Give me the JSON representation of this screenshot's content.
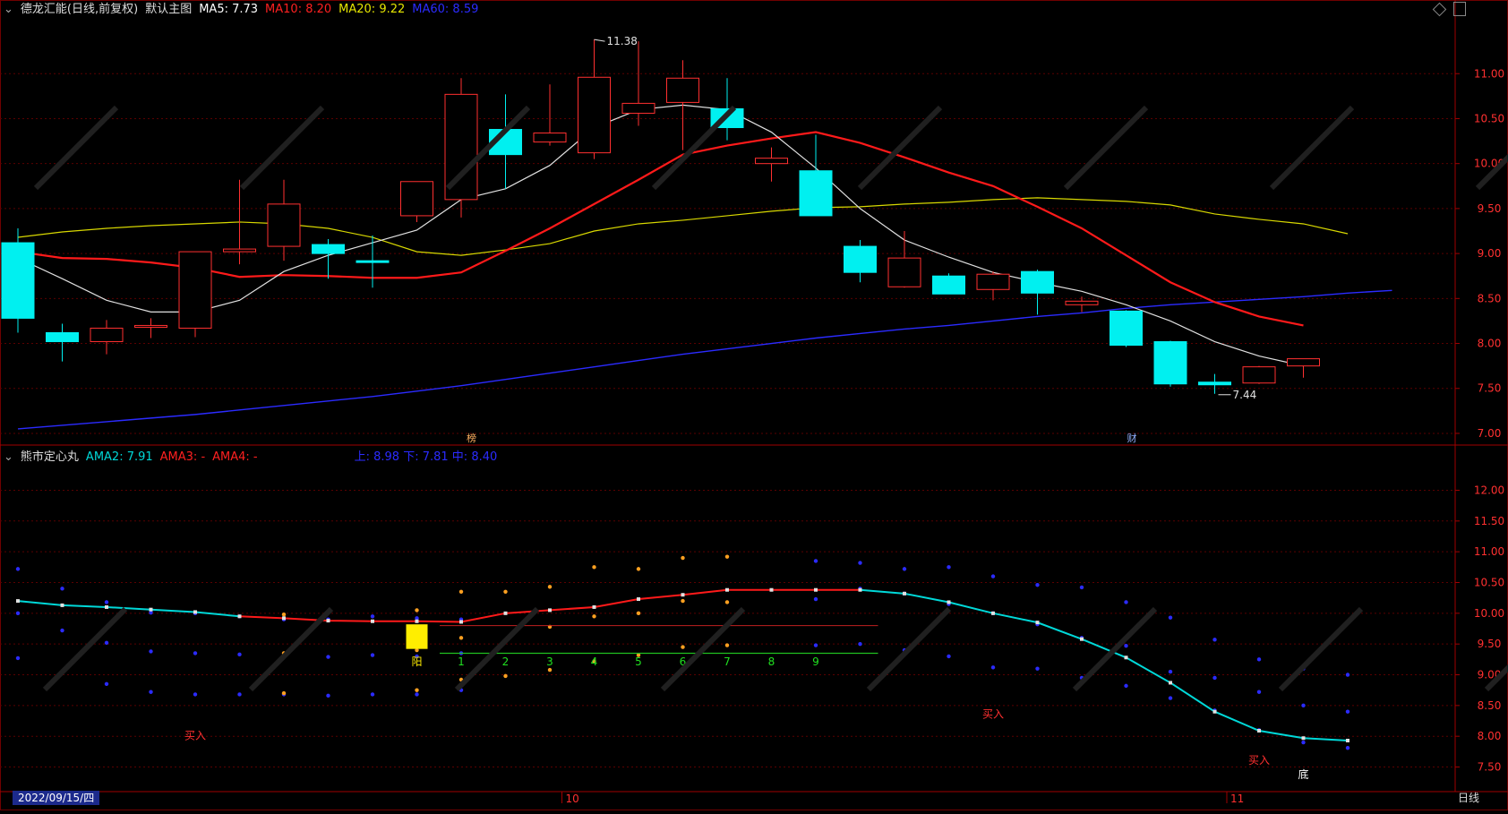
{
  "main": {
    "title": "德龙汇能(日线,前复权)",
    "chart_name": "默认主图",
    "ma": [
      {
        "label": "MA5: 7.73",
        "color": "#ffffff"
      },
      {
        "label": "MA10: 8.20",
        "color": "#ff2020"
      },
      {
        "label": "MA20: 9.22",
        "color": "#e6e600"
      },
      {
        "label": "MA60: 8.59",
        "color": "#2b2bff"
      }
    ],
    "high_label": "11.38",
    "low_label": "7.44",
    "event_marker_1": "榜",
    "event_marker_2": "财"
  },
  "sub": {
    "title": "熊市定心丸",
    "ama2": "AMA2: 7.91",
    "ama3": "AMA3: -",
    "ama4": "AMA4: -",
    "band": "上: 8.98  下: 7.81  中: 8.40",
    "yang_label": "阳",
    "counts": [
      "1",
      "2",
      "3",
      "4",
      "5",
      "6",
      "7",
      "8",
      "9"
    ],
    "buy_label": "买入",
    "bottom_label": "底"
  },
  "footer": {
    "date": "2022/09/15/四",
    "month_oct": "10",
    "month_nov": "11",
    "period_tab": "日线"
  },
  "colors": {
    "up": "#ff3030",
    "down": "#00f0f0",
    "grid": "#5a0000",
    "axis_text": "#ff3030",
    "ama2": "#00d8d8"
  },
  "chart_data": [
    {
      "type": "candlestick",
      "ylim": [
        6.9,
        11.6
      ],
      "yticks": [
        "7.00",
        "7.50",
        "8.00",
        "8.50",
        "9.00",
        "9.50",
        "10.00",
        "10.50",
        "11.00"
      ],
      "candles": [
        {
          "o": 9.12,
          "h": 9.28,
          "l": 8.12,
          "c": 8.28
        },
        {
          "o": 8.12,
          "h": 8.22,
          "l": 7.8,
          "c": 8.02
        },
        {
          "o": 8.02,
          "h": 8.26,
          "l": 7.88,
          "c": 8.17
        },
        {
          "o": 8.18,
          "h": 8.28,
          "l": 8.06,
          "c": 8.2
        },
        {
          "o": 8.17,
          "h": 9.02,
          "l": 8.07,
          "c": 9.02
        },
        {
          "o": 9.02,
          "h": 9.82,
          "l": 8.88,
          "c": 9.05
        },
        {
          "o": 9.08,
          "h": 9.82,
          "l": 8.92,
          "c": 9.55
        },
        {
          "o": 9.1,
          "h": 9.16,
          "l": 8.72,
          "c": 9.0
        },
        {
          "o": 8.92,
          "h": 9.2,
          "l": 8.62,
          "c": 8.9
        },
        {
          "o": 9.42,
          "h": 9.8,
          "l": 9.35,
          "c": 9.8
        },
        {
          "o": 9.6,
          "h": 10.95,
          "l": 9.4,
          "c": 10.77
        },
        {
          "o": 10.38,
          "h": 10.77,
          "l": 9.72,
          "c": 10.1
        },
        {
          "o": 10.24,
          "h": 10.88,
          "l": 10.2,
          "c": 10.34
        },
        {
          "o": 10.12,
          "h": 11.38,
          "l": 10.05,
          "c": 10.96
        },
        {
          "o": 10.56,
          "h": 11.36,
          "l": 10.42,
          "c": 10.67
        },
        {
          "o": 10.68,
          "h": 11.15,
          "l": 10.15,
          "c": 10.95
        },
        {
          "o": 10.61,
          "h": 10.95,
          "l": 10.26,
          "c": 10.4
        },
        {
          "o": 10.0,
          "h": 10.18,
          "l": 9.8,
          "c": 10.06
        },
        {
          "o": 9.92,
          "h": 10.32,
          "l": 9.42,
          "c": 9.42
        },
        {
          "o": 9.08,
          "h": 9.15,
          "l": 8.68,
          "c": 8.79
        },
        {
          "o": 8.63,
          "h": 9.25,
          "l": 8.62,
          "c": 8.95
        },
        {
          "o": 8.75,
          "h": 8.78,
          "l": 8.55,
          "c": 8.55
        },
        {
          "o": 8.6,
          "h": 8.8,
          "l": 8.48,
          "c": 8.77
        },
        {
          "o": 8.8,
          "h": 8.82,
          "l": 8.32,
          "c": 8.56
        },
        {
          "o": 8.43,
          "h": 8.52,
          "l": 8.35,
          "c": 8.47
        },
        {
          "o": 8.36,
          "h": 8.37,
          "l": 7.96,
          "c": 7.98
        },
        {
          "o": 8.02,
          "h": 8.03,
          "l": 7.52,
          "c": 7.55
        },
        {
          "o": 7.57,
          "h": 7.66,
          "l": 7.44,
          "c": 7.54
        },
        {
          "o": 7.56,
          "h": 7.75,
          "l": 7.55,
          "c": 7.74
        },
        {
          "o": 7.75,
          "h": 7.82,
          "l": 7.62,
          "c": 7.83
        }
      ],
      "ma5": [
        8.95,
        8.72,
        8.48,
        8.35,
        8.35,
        8.48,
        8.8,
        8.98,
        9.12,
        9.26,
        9.6,
        9.72,
        9.98,
        10.4,
        10.6,
        10.65,
        10.6,
        10.35,
        9.95,
        9.5,
        9.15,
        8.96,
        8.79,
        8.68,
        8.58,
        8.43,
        8.25,
        8.02,
        7.86,
        7.75
      ],
      "ma10": [
        9.02,
        8.95,
        8.94,
        8.9,
        8.84,
        8.74,
        8.76,
        8.75,
        8.73,
        8.73,
        8.79,
        9.03,
        9.28,
        9.55,
        9.82,
        10.1,
        10.2,
        10.28,
        10.35,
        10.23,
        10.07,
        9.9,
        9.75,
        9.52,
        9.28,
        8.98,
        8.68,
        8.46,
        8.3,
        8.2
      ],
      "ma20": [
        9.18,
        9.24,
        9.28,
        9.31,
        9.33,
        9.35,
        9.33,
        9.28,
        9.18,
        9.02,
        8.98,
        9.04,
        9.11,
        9.25,
        9.33,
        9.37,
        9.42,
        9.47,
        9.51,
        9.52,
        9.55,
        9.57,
        9.6,
        9.62,
        9.6,
        9.58,
        9.54,
        9.44,
        9.38,
        9.33,
        9.22
      ],
      "ma60": [
        7.05,
        7.09,
        7.13,
        7.17,
        7.21,
        7.26,
        7.31,
        7.36,
        7.41,
        7.47,
        7.53,
        7.6,
        7.67,
        7.74,
        7.81,
        7.88,
        7.94,
        8.0,
        8.06,
        8.11,
        8.16,
        8.2,
        8.25,
        8.3,
        8.34,
        8.39,
        8.43,
        8.46,
        8.49,
        8.52,
        8.56,
        8.59
      ]
    },
    {
      "type": "line",
      "ylim": [
        7.1,
        12.4
      ],
      "yticks": [
        "7.50",
        "8.00",
        "8.50",
        "9.00",
        "9.50",
        "10.00",
        "10.50",
        "11.00",
        "11.50",
        "12.00"
      ],
      "ama2": [
        10.2,
        10.13,
        10.1,
        10.06,
        10.02,
        9.95,
        9.92,
        9.88,
        9.87,
        9.87,
        9.86,
        10.0,
        10.05,
        10.1,
        10.23,
        10.3,
        10.38,
        10.38,
        10.38,
        10.38,
        10.32,
        10.18,
        10.0,
        9.85,
        9.58,
        9.28,
        8.87,
        8.4,
        8.09,
        7.97,
        7.93
      ],
      "dots_blue": [
        [
          10.72,
          10.0,
          9.27
        ],
        [
          10.4,
          9.72,
          9.04
        ],
        [
          10.18,
          9.52,
          8.85
        ],
        [
          10.01,
          9.38,
          8.72
        ],
        [
          10.0,
          9.35,
          8.68
        ],
        [
          9.95,
          9.33,
          8.68
        ],
        [
          9.9,
          9.3,
          8.68
        ],
        [
          9.9,
          9.29,
          8.66
        ],
        [
          9.95,
          9.32,
          8.68
        ],
        [
          9.92,
          9.3,
          8.68
        ],
        [
          9.9,
          9.35,
          8.75
        ],
        [
          null,
          null,
          null
        ],
        [
          null,
          null,
          null
        ],
        [
          null,
          null,
          null
        ],
        [
          null,
          null,
          null
        ],
        [
          null,
          null,
          null
        ],
        [
          null,
          null,
          null
        ],
        [
          null,
          null,
          null
        ],
        [
          10.85,
          10.23,
          9.48
        ],
        [
          10.82,
          10.4,
          9.5
        ],
        [
          10.72,
          10.32,
          9.4
        ],
        [
          10.75,
          10.15,
          9.3
        ],
        [
          10.6,
          10.0,
          9.12
        ],
        [
          10.46,
          9.82,
          9.1
        ],
        [
          10.42,
          9.6,
          8.95
        ],
        [
          10.18,
          9.47,
          8.82
        ],
        [
          9.93,
          9.05,
          8.62
        ],
        [
          9.57,
          8.95,
          8.42
        ],
        [
          9.25,
          8.72,
          8.1
        ],
        [
          9.1,
          8.5,
          7.9
        ],
        [
          9.0,
          8.4,
          7.81
        ]
      ],
      "dots_orange": [
        [
          null,
          null,
          null
        ],
        [
          null,
          null,
          null
        ],
        [
          null,
          null,
          null
        ],
        [
          null,
          null,
          null
        ],
        [
          null,
          null,
          null
        ],
        [
          null,
          null,
          null
        ],
        [
          9.98,
          9.35,
          8.7
        ],
        [
          null,
          null,
          null
        ],
        [
          null,
          null,
          null
        ],
        [
          10.05,
          9.4,
          8.75
        ],
        [
          10.35,
          9.6,
          8.92
        ],
        [
          10.35,
          9.55,
          8.98
        ],
        [
          10.43,
          9.78,
          9.08
        ],
        [
          10.75,
          9.95,
          9.22
        ],
        [
          10.72,
          10.0,
          9.32
        ],
        [
          10.9,
          10.2,
          9.45
        ],
        [
          10.92,
          10.18,
          9.48
        ],
        [
          null,
          null,
          null
        ],
        [
          null,
          null,
          null
        ],
        [
          null,
          null,
          null
        ],
        [
          null,
          null,
          null
        ],
        [
          null,
          null,
          null
        ],
        [
          null,
          null,
          null
        ],
        [
          null,
          null,
          null
        ],
        [
          null,
          null,
          null
        ],
        [
          null,
          null,
          null
        ],
        [
          null,
          null,
          null
        ],
        [
          null,
          null,
          null
        ],
        [
          null,
          null,
          null
        ],
        [
          null,
          null,
          null
        ],
        [
          null,
          null,
          null
        ]
      ]
    }
  ]
}
